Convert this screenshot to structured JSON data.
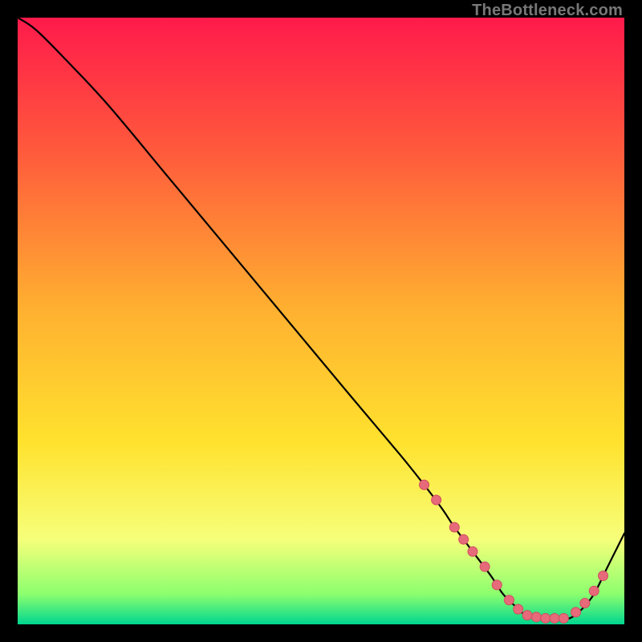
{
  "watermark": "TheBottleneck.com",
  "chart_data": {
    "type": "line",
    "title": "",
    "xlabel": "",
    "ylabel": "",
    "xlim": [
      0,
      100
    ],
    "ylim": [
      0,
      100
    ],
    "x": [
      0,
      3,
      8,
      15,
      25,
      35,
      45,
      55,
      63,
      67,
      70,
      72,
      75,
      78,
      80,
      82,
      83,
      85,
      87,
      89,
      91,
      93,
      95,
      97,
      99,
      100
    ],
    "values": [
      100,
      98,
      93,
      85.5,
      73.5,
      61.5,
      49.5,
      37.5,
      28,
      23,
      19,
      16,
      12,
      8,
      5,
      3,
      2,
      1.2,
      1.0,
      1.0,
      1.0,
      2.5,
      5,
      9,
      13,
      15
    ],
    "markers_x": [
      67,
      69,
      72,
      73.5,
      75,
      77,
      79,
      81,
      82.5,
      84,
      85.5,
      87,
      88.5,
      90,
      92,
      93.5,
      95,
      96.5
    ],
    "markers_y": [
      23,
      20.5,
      16,
      14,
      12,
      9.5,
      6.5,
      4,
      2.5,
      1.5,
      1.2,
      1.0,
      1.0,
      1.0,
      2.0,
      3.5,
      5.5,
      8.0
    ]
  },
  "gradient": {
    "top": "#ff1a4b",
    "upper": "#ff5a3c",
    "mid": "#ffb030",
    "lower": "#ffe22e",
    "pale": "#f6ff7a",
    "band": "#8cff6e",
    "bottom": "#00d68f"
  },
  "curve_stroke": "#000000",
  "marker_fill": "#e66a7a",
  "marker_stroke": "#d14e60"
}
